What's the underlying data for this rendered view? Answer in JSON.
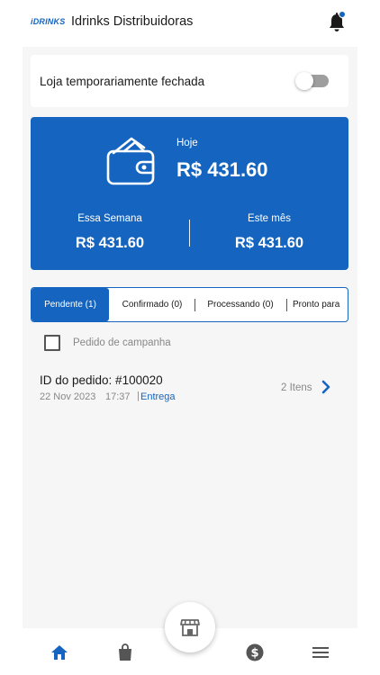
{
  "header": {
    "logo_text": "iDRINKS",
    "store_name": "Idrinks Distribuidoras",
    "notification_icon": "bell-icon",
    "notification_dot_color": "#1565c0"
  },
  "store_status": {
    "label": "Loja temporariamente fechada",
    "toggle_on": false
  },
  "balance": {
    "icon": "wallet-icon",
    "today_label": "Hoje",
    "today_value": "R$ 431.60",
    "week_label": "Essa Semana",
    "week_value": "R$ 431.60",
    "month_label": "Este mês",
    "month_value": "R$ 431.60",
    "card_color": "#1565c0"
  },
  "tabs": [
    {
      "label": "Pendente (1)",
      "active": true
    },
    {
      "label": "Confirmado (0)",
      "active": false
    },
    {
      "label": "Processando (0)",
      "active": false
    },
    {
      "label": "Pronto para",
      "active": false
    }
  ],
  "campaign_filter": {
    "label": "Pedido de campanha",
    "checked": false
  },
  "orders": [
    {
      "id_label": "ID do pedido: #100020",
      "date": "22 Nov 2023",
      "time": "17:37",
      "separator": "|",
      "type": "Entrega",
      "items": "2 Itens"
    }
  ],
  "bottom_nav": {
    "items": [
      "home-icon",
      "shopping-bag-icon",
      "store-icon",
      "dollar-icon",
      "menu-icon"
    ],
    "active": "home-icon",
    "accent_color": "#1565c0"
  }
}
